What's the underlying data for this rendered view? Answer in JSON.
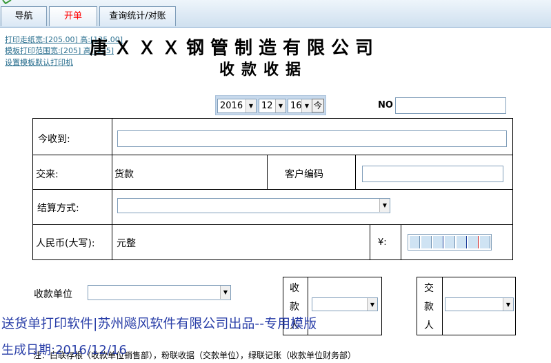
{
  "tabs": [
    {
      "label": "导航"
    },
    {
      "label": "开单"
    },
    {
      "label": "查询统计/对账"
    }
  ],
  "links": {
    "paper_size": "打印走纸宽:[205.00] 高:[135.00]",
    "template_range": "模板打印范围宽:[205] 高:[135]",
    "default_printer": "设置模板默认打印机"
  },
  "header": {
    "company": "唐ＸＸＸ钢管制造有限公司",
    "doc_title": "收款收据"
  },
  "date": {
    "year": "2016",
    "month": "12",
    "day": "16",
    "today_label": "今"
  },
  "no_label": "NO",
  "form": {
    "received_label": "今收到:",
    "payfor_label": "交来:",
    "payfor_value": "货款",
    "customer_code_label": "客户编码",
    "settle_label": "结算方式:",
    "rmb_label": "人民币(大写):",
    "rmb_value": "元整",
    "yen_label": "¥:"
  },
  "signatures": {
    "unit_label": "收款单位",
    "receiver_label": [
      "收",
      "款",
      "人"
    ],
    "payer_label": [
      "交",
      "款",
      "人"
    ]
  },
  "footer": {
    "promo": "送货单打印软件|苏州飚风软件有限公司出品--专用模版",
    "gen_date": "生成日期:2016/12/16",
    "note": "注：白联存根（收款单位销售部），粉联收据（交款单位），绿联记账（收款单位财务部）"
  },
  "colors": {
    "active_tab_text": "#ff0000",
    "link": "#2a6f8f",
    "promo": "#2a3fa8"
  }
}
